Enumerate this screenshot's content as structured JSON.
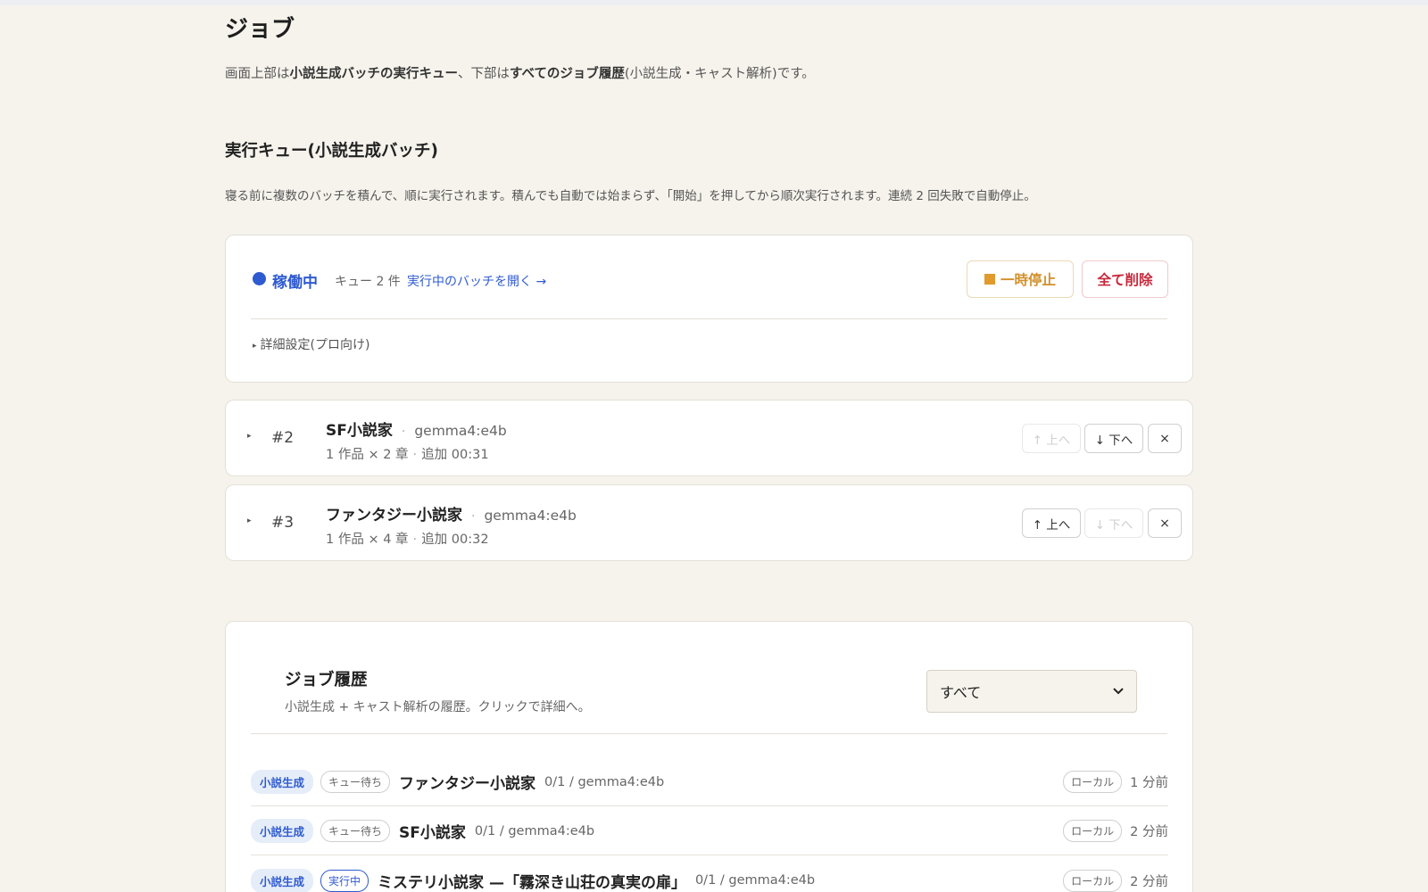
{
  "page": {
    "title": "ジョブ",
    "desc_parts": [
      "画面上部は",
      "小説生成バッチの実行キュー",
      "、下部は",
      "すべてのジョブ履歴",
      "(小説生成・キャスト解析)です。"
    ]
  },
  "queue": {
    "title": "実行キュー(小説生成バッチ)",
    "desc": "寝る前に複数のバッチを積んで、順に実行されます。積んでも自動では始まらず、「開始」を押してから順次実行されます。連続 2 回失敗で自動停止。",
    "status_label": "稼働中",
    "count": "キュー 2 件",
    "separator": "·",
    "open_link": "実行中のバッチを開く →",
    "pause_label": "一時停止",
    "delete_all_label": "全て削除",
    "advanced_label": "詳細設定(プロ向け)",
    "status_color": "#2f5bd0",
    "batches": [
      {
        "num": "#2",
        "name": "SF小説家",
        "model": "gemma4:e4b",
        "works": "1 作品 × 2 章",
        "added": "追加 00:31",
        "up_label": "↑ 上へ",
        "down_label": "↓ 下へ",
        "remove_label": "×",
        "up_enabled": false,
        "down_enabled": true
      },
      {
        "num": "#3",
        "name": "ファンタジー小説家",
        "model": "gemma4:e4b",
        "works": "1 作品 × 4 章",
        "added": "追加 00:32",
        "up_label": "↑ 上へ",
        "down_label": "↓ 下へ",
        "remove_label": "×",
        "up_enabled": true,
        "down_enabled": false
      }
    ]
  },
  "history": {
    "title": "ジョブ履歴",
    "desc": "小説生成 + キャスト解析の履歴。クリックで詳細へ。",
    "filter_value": "すべて",
    "rows": [
      {
        "type": "小説生成",
        "status": "キュー待ち",
        "name": "ファンタジー小説家",
        "meta": "0/1 / gemma4:e4b",
        "location": "ローカル",
        "time": "1 分前"
      },
      {
        "type": "小説生成",
        "status": "キュー待ち",
        "name": "SF小説家",
        "meta": "0/1 / gemma4:e4b",
        "location": "ローカル",
        "time": "2 分前"
      },
      {
        "type": "小説生成",
        "status": "実行中",
        "name": "ミステリ小説家 —「霧深き山荘の真実の扉」",
        "meta": "0/1 / gemma4:e4b",
        "location": "ローカル",
        "time": "2 分前"
      }
    ]
  }
}
